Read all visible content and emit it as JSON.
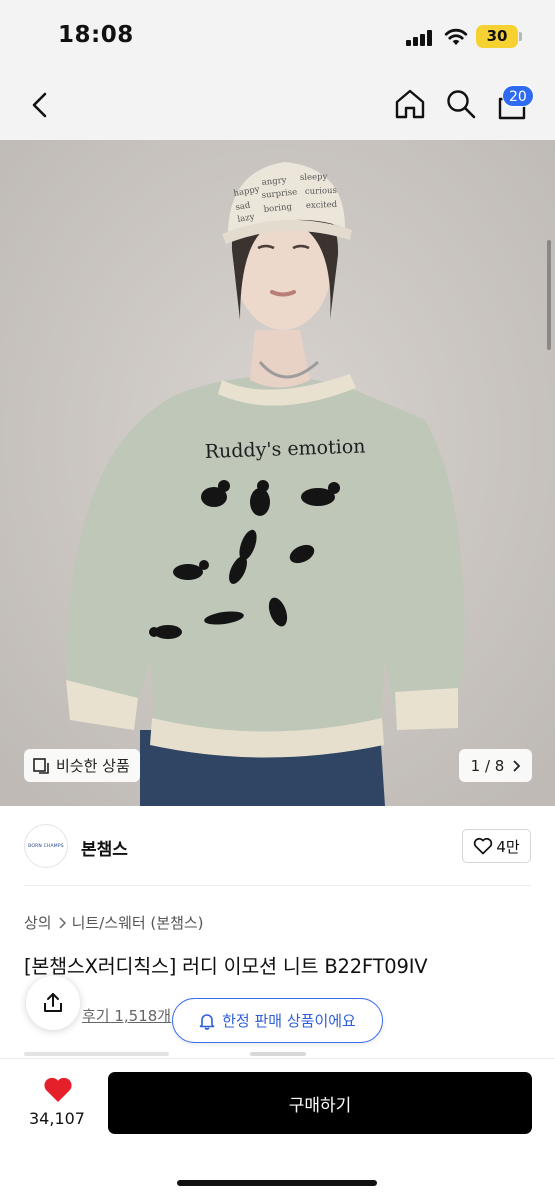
{
  "status_bar": {
    "time": "18:08",
    "battery": "30"
  },
  "nav": {
    "back_icon": "chevron-left-icon",
    "home_icon": "home-icon",
    "search_icon": "search-icon",
    "cart_icon": "cart-icon",
    "cart_count": "20"
  },
  "hero": {
    "cap_text_lines": [
      "happy",
      "angry",
      "sleepy",
      "sad",
      "surprise",
      "curious",
      "lazy",
      "boring",
      "excited"
    ],
    "sweater_text": "Ruddy's emotion",
    "similar_button": "비슷한 상품",
    "page_indicator": "1 / 8"
  },
  "brand": {
    "logo_text": "BORN CHAMPS",
    "name": "본챔스",
    "like_label": "4만"
  },
  "breadcrumb": {
    "level1": "상의",
    "level2": "니트/스웨터 (본챔스)"
  },
  "product": {
    "title": "[본챔스X러디칙스] 러디 이모션 니트 B22FT09IV"
  },
  "reviews": {
    "text": "후기 1,518개"
  },
  "toast": {
    "text": "한정 판매 상품이에요"
  },
  "bottom": {
    "like_count": "34,107",
    "buy_label": "구매하기"
  },
  "colors": {
    "accent_blue": "#2f6bf0",
    "heart_red": "#e5202a",
    "buy_black": "#000000"
  }
}
